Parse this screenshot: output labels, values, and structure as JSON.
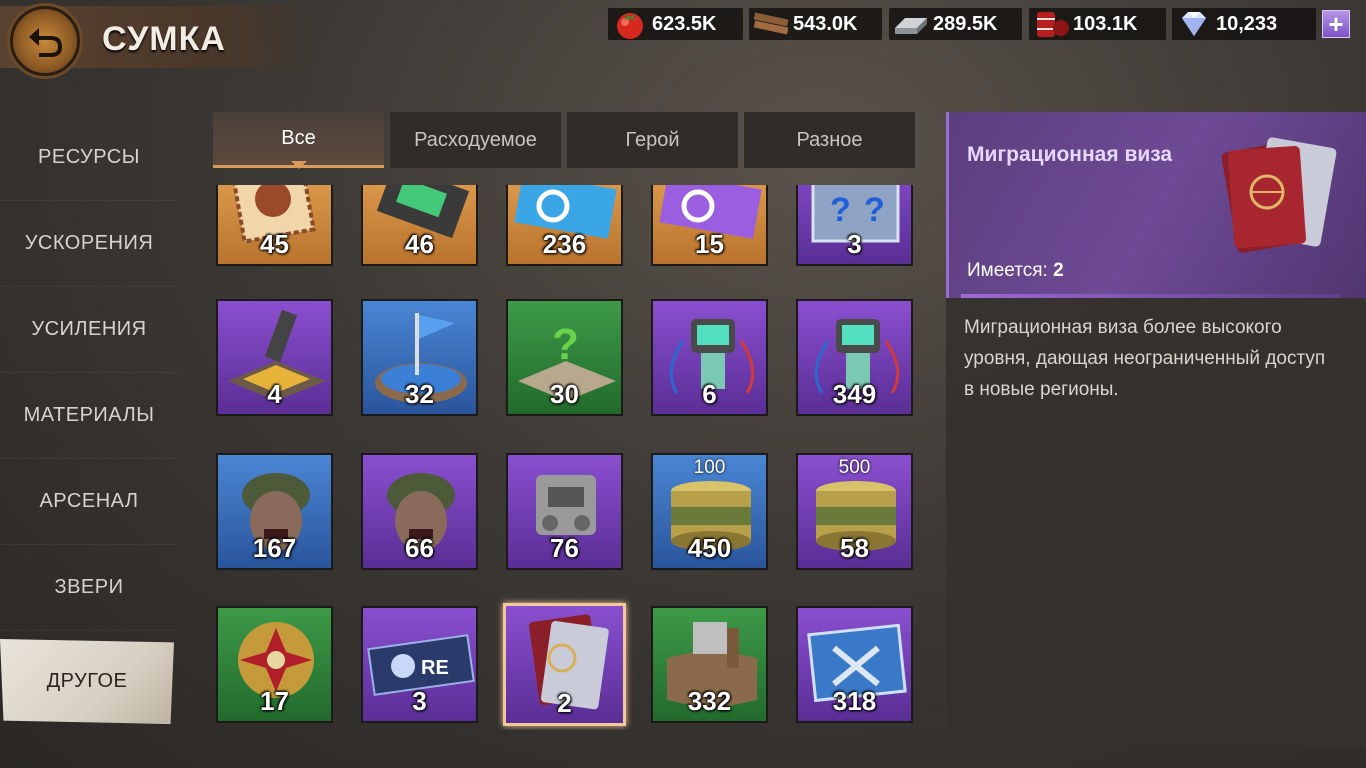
{
  "header": {
    "title": "СУМКА"
  },
  "resources": [
    {
      "name": "food",
      "icon": "tomato-icon",
      "value": "623.5K"
    },
    {
      "name": "wood",
      "icon": "planks-icon",
      "value": "543.0K"
    },
    {
      "name": "steel",
      "icon": "steel-bar-icon",
      "value": "289.5K"
    },
    {
      "name": "oil",
      "icon": "oil-barrel-icon",
      "value": "103.1K"
    },
    {
      "name": "diamonds",
      "icon": "diamond-icon",
      "value": "10,233"
    }
  ],
  "sidebar": {
    "items": [
      {
        "label": "РЕСУРСЫ"
      },
      {
        "label": "УСКОРЕНИЯ"
      },
      {
        "label": "УСИЛЕНИЯ"
      },
      {
        "label": "МАТЕРИАЛЫ"
      },
      {
        "label": "АРСЕНАЛ"
      },
      {
        "label": "ЗВЕРИ"
      },
      {
        "label": "ДРУГОЕ"
      }
    ],
    "active": "ДРУГОЕ"
  },
  "tabs": [
    {
      "label": "Все"
    },
    {
      "label": "Расходуемое"
    },
    {
      "label": "Герой"
    },
    {
      "label": "Разное"
    }
  ],
  "active_tab": "Все",
  "items": [
    {
      "icon": "stamped-card-icon",
      "rarity": "orange",
      "qty": "45"
    },
    {
      "icon": "chip-module-icon",
      "rarity": "orange",
      "qty": "46"
    },
    {
      "icon": "blue-refresh-ticket-icon",
      "rarity": "orange",
      "qty": "236"
    },
    {
      "icon": "purple-refresh-ticket-icon",
      "rarity": "orange",
      "qty": "15"
    },
    {
      "icon": "mystery-box-icon",
      "rarity": "purple",
      "qty": "3"
    },
    {
      "icon": "arrow-switch-pad-icon",
      "rarity": "purple",
      "qty": "4"
    },
    {
      "icon": "flag-teleport-pad-icon",
      "rarity": "blue",
      "qty": "32"
    },
    {
      "icon": "question-pad-icon",
      "rarity": "green",
      "qty": "30"
    },
    {
      "icon": "detonator-device-icon",
      "rarity": "purple",
      "qty": "6"
    },
    {
      "icon": "detonator-device-icon",
      "rarity": "purple",
      "qty": "349"
    },
    {
      "icon": "zombie-soldier-icon",
      "rarity": "blue",
      "qty": "167"
    },
    {
      "icon": "zombie-soldier-icon",
      "rarity": "purple",
      "qty": "66"
    },
    {
      "icon": "robot-parts-icon",
      "rarity": "purple",
      "qty": "76"
    },
    {
      "icon": "meat-can-icon",
      "rarity": "blue",
      "qty": "450",
      "badge": "100"
    },
    {
      "icon": "meat-can-icon",
      "rarity": "purple",
      "qty": "58",
      "badge": "500"
    },
    {
      "icon": "medal-icon",
      "rarity": "green",
      "qty": "17"
    },
    {
      "icon": "rename-ticket-icon",
      "rarity": "purple",
      "qty": "3"
    },
    {
      "icon": "passport-icon",
      "rarity": "purple",
      "qty": "2",
      "selected": true
    },
    {
      "icon": "scrap-crate-icon",
      "rarity": "green",
      "qty": "332"
    },
    {
      "icon": "blueprint-tools-icon",
      "rarity": "purple",
      "qty": "318"
    }
  ],
  "detail": {
    "title": "Миграционная виза",
    "icon": "passport-icon",
    "owned_label": "Имеется:",
    "owned_value": "2",
    "description": "Миграционная виза более высокого уровня, дающая неограниченный доступ в новые регионы."
  },
  "colors": {
    "orange": "#e8a756",
    "purple": "#8a4fd0",
    "blue": "#4a86d4",
    "green": "#3d9a48",
    "accent": "#d99c5a"
  }
}
